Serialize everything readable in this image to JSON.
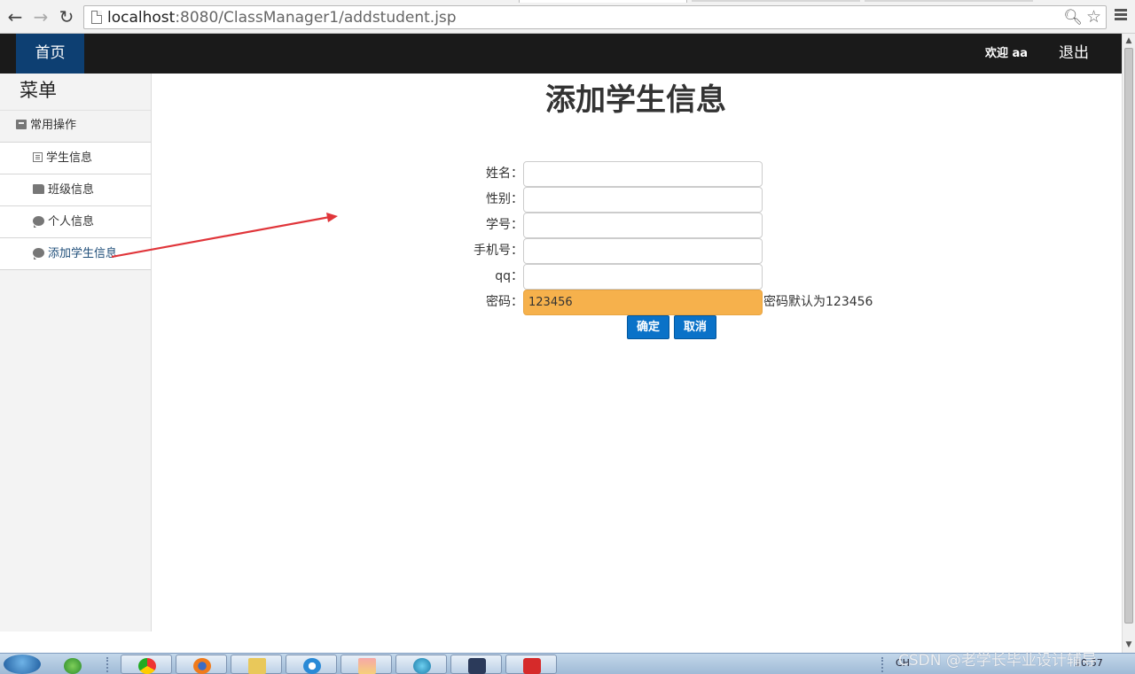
{
  "browser": {
    "url_host": "localhost",
    "url_path": ":8080/ClassManager1/addstudent.jsp"
  },
  "navbar": {
    "home": "首页",
    "welcome": "欢迎 aa",
    "logout": "退出"
  },
  "sidebar": {
    "title": "菜单",
    "group": "常用操作",
    "items": [
      {
        "label": "学生信息",
        "icon": "list-icon"
      },
      {
        "label": "班级信息",
        "icon": "group-icon"
      },
      {
        "label": "个人信息",
        "icon": "chat-icon"
      },
      {
        "label": "添加学生信息",
        "icon": "chat-icon"
      }
    ]
  },
  "form": {
    "title": "添加学生信息",
    "fields": [
      {
        "label": "姓名：",
        "value": ""
      },
      {
        "label": "性别：",
        "value": ""
      },
      {
        "label": "学号：",
        "value": ""
      },
      {
        "label": "手机号：",
        "value": ""
      },
      {
        "label": "qq：",
        "value": ""
      },
      {
        "label": "密码：",
        "value": "123456"
      }
    ],
    "password_hint": "密码默认为123456",
    "confirm": "确定",
    "cancel": "取消"
  },
  "taskbar": {
    "lang": "CH",
    "clock": "10:57"
  },
  "watermark": "CSDN @老学长毕业设计辅导",
  "colors": {
    "navbar_bg": "#1a1a1a",
    "home_bg": "#0d3f72",
    "button_bg": "#0a72c8",
    "password_bg": "#f6b14c",
    "arrow": "#e0353a"
  }
}
